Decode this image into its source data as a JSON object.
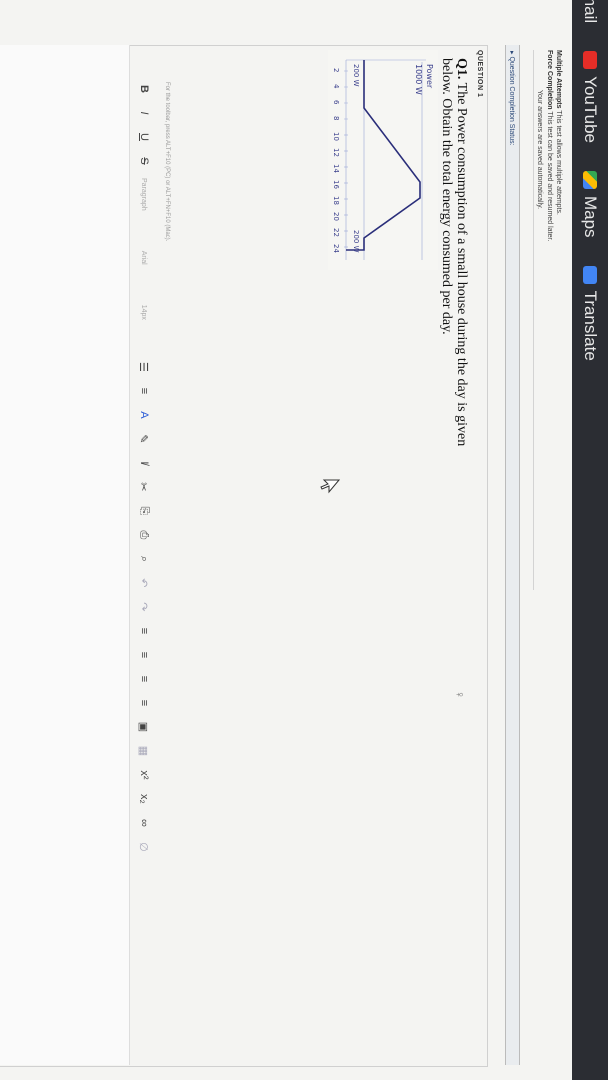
{
  "bookmarks": {
    "gmail": "mail",
    "youtube": "YouTube",
    "maps": "Maps",
    "translate": "Translate"
  },
  "test_info": {
    "multiple_attempts_label": "Multiple Attempts",
    "multiple_attempts_text": "This test allows multiple attempts.",
    "force_completion_label": "Force Completion",
    "force_completion_text": "This test can be saved and resumed later.",
    "autosave_text": "Your answers are saved automatically."
  },
  "completion_status": "▸ Question Completion Status:",
  "question": {
    "label": "QUESTION 1",
    "number": "Q1.",
    "text": "The Power consumption of a small house during the day is given below. Obtain the total energy consumed per day."
  },
  "graph": {
    "axis_label": "Power",
    "peak_label": "1000 W",
    "left_label": "200 W",
    "right_label": "200 W",
    "ticks": [
      "2",
      "4",
      "6",
      "8",
      "10",
      "12",
      "14",
      "16",
      "18",
      "20",
      "22",
      "24"
    ]
  },
  "editor": {
    "hint": "For the toolbar, press ALT+F10 (PC) or ALT+FN+F10 (Mac).",
    "paragraph": "Paragraph",
    "font": "Arial",
    "size": "14px",
    "buttons": {
      "bold": "B",
      "italic": "I",
      "underline": "U",
      "strike": "S",
      "bullets": "☰",
      "numbers": "≡",
      "text_color": "A",
      "highlight": "✎",
      "clear": "I̸",
      "cut": "✂",
      "copy": "⎘",
      "paste": "⎙",
      "search": "⌕",
      "undo": "↶",
      "redo": "↷",
      "align_left": "≡",
      "align_center": "≡",
      "align_right": "≡",
      "align_justify": "≡",
      "image": "▣",
      "more": "▦",
      "superscript": "x²",
      "subscript": "x₂",
      "link": "∞",
      "unlink": "∅"
    }
  }
}
